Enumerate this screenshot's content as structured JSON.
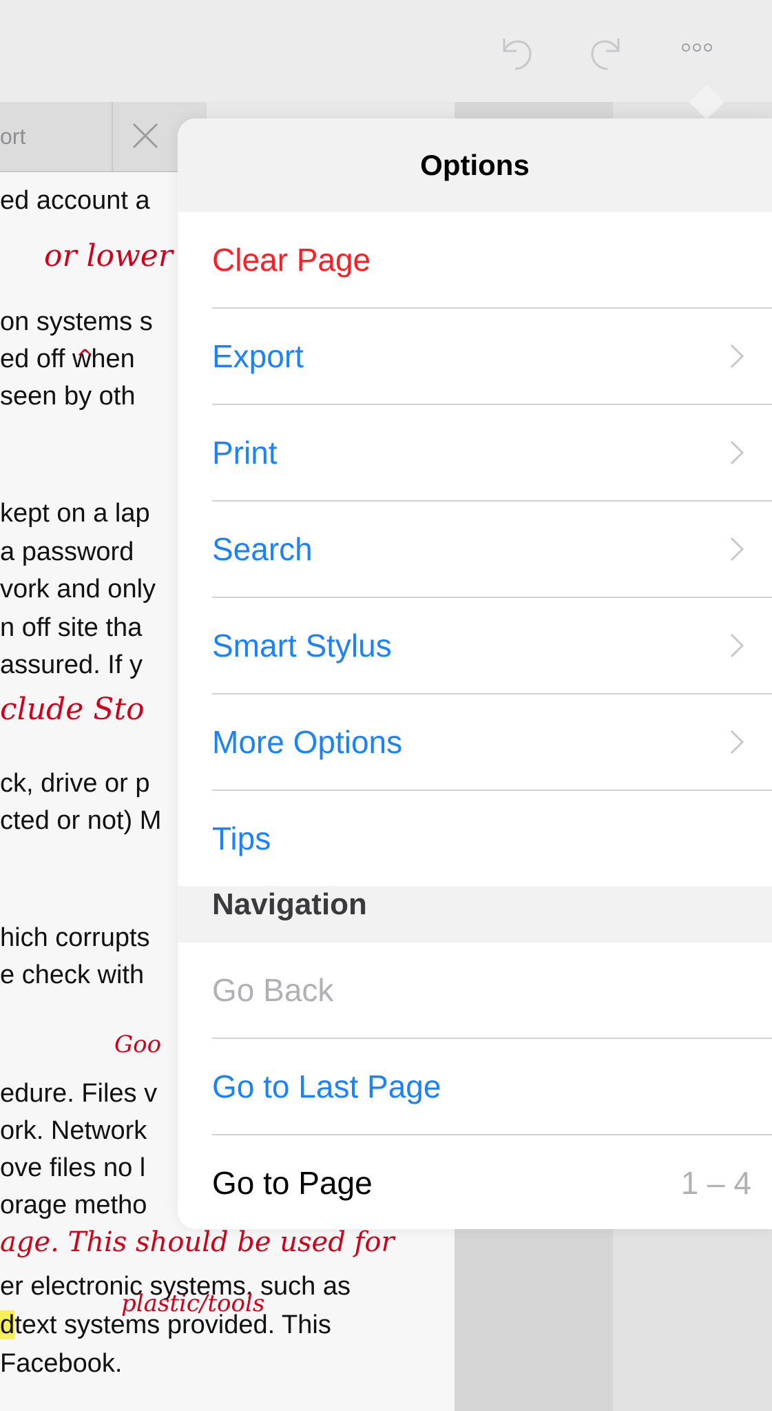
{
  "toolbar": {
    "undo_icon": "undo-icon",
    "redo_icon": "redo-icon",
    "more_icon": "more-options-icon"
  },
  "tab": {
    "label": "ort",
    "close_icon": "close-icon"
  },
  "document": {
    "lines": [
      "ed account a",
      "on systems s",
      "ed off when",
      "seen by oth",
      "kept on a lap",
      " a password",
      "vork and only",
      "n off site tha",
      "assured. If y",
      "ck, drive or p",
      "cted or not) M",
      "hich corrupts",
      "e check with",
      "edure. Files v",
      "ork.  Network",
      "ove files no l",
      "orage metho",
      "er electronic systems, such as",
      "text systems provided. This",
      "Facebook."
    ],
    "highlight_letter": "d",
    "ink_notes": [
      "or lower",
      "^",
      "clude Sto",
      "Goo",
      "age. This should be used for",
      "plastic/tools"
    ]
  },
  "popover": {
    "title": "Options",
    "options": [
      {
        "label": "Clear Page",
        "style": "red",
        "chevron": false
      },
      {
        "label": "Export",
        "style": "blue",
        "chevron": true
      },
      {
        "label": "Print",
        "style": "blue",
        "chevron": true
      },
      {
        "label": "Search",
        "style": "blue",
        "chevron": true
      },
      {
        "label": "Smart Stylus",
        "style": "blue",
        "chevron": true
      },
      {
        "label": "More Options",
        "style": "blue",
        "chevron": true
      },
      {
        "label": "Tips",
        "style": "blue",
        "chevron": false
      }
    ],
    "navigation_header": "Navigation",
    "navigation": [
      {
        "label": "Go Back",
        "style": "grey"
      },
      {
        "label": "Go to Last Page",
        "style": "blue"
      },
      {
        "label": "Go to Page",
        "style": "black",
        "range": "1 – 4"
      }
    ]
  },
  "colors": {
    "accent_blue": "#1a82fb",
    "destructive_red": "#ff1d25",
    "disabled_grey": "#b0b0b5",
    "ink_red": "#d0021b"
  }
}
